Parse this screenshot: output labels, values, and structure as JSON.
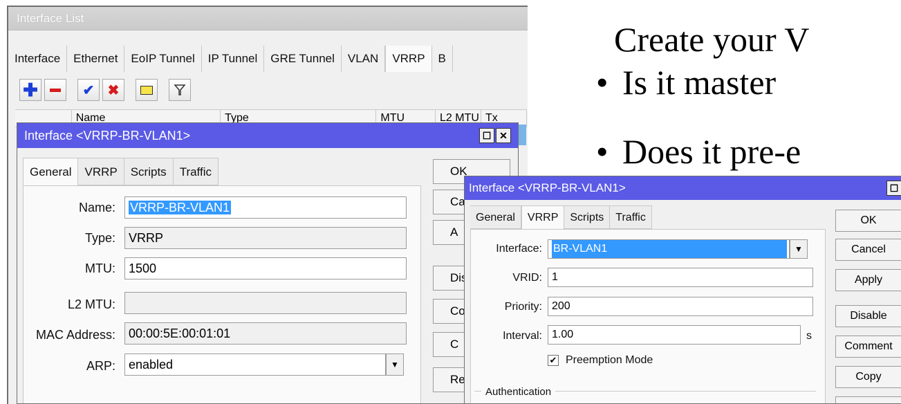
{
  "slide": {
    "title": "Create your V",
    "bullets": [
      "Is it master",
      "Does it pre-e"
    ],
    "bullet_char": "•"
  },
  "interface_list": {
    "title": "Interface List",
    "tabs": [
      "Interface",
      "Ethernet",
      "EoIP Tunnel",
      "IP Tunnel",
      "GRE Tunnel",
      "VLAN",
      "VRRP",
      "B"
    ],
    "active_tab": "VRRP",
    "toolbar": [
      "add-icon",
      "remove-icon",
      "enable-icon",
      "disable-icon",
      "comment-icon",
      "filter-icon"
    ],
    "columns": [
      "",
      "Name",
      "Type",
      "MTU",
      "L2 MTU",
      "Tx"
    ]
  },
  "dialog_general": {
    "title": "Interface <VRRP-BR-VLAN1>",
    "tabs": [
      "General",
      "VRRP",
      "Scripts",
      "Traffic"
    ],
    "active_tab": "General",
    "fields": {
      "name": {
        "label": "Name:",
        "value": "VRRP-BR-VLAN1"
      },
      "type": {
        "label": "Type:",
        "value": "VRRP"
      },
      "mtu": {
        "label": "MTU:",
        "value": "1500"
      },
      "l2mtu": {
        "label": "L2 MTU:",
        "value": ""
      },
      "mac": {
        "label": "MAC Address:",
        "value": "00:00:5E:00:01:01"
      },
      "arp": {
        "label": "ARP:",
        "value": "enabled"
      }
    },
    "buttons": [
      "OK",
      "Ca",
      "A",
      "Dis",
      "Con",
      "C",
      "Re"
    ]
  },
  "dialog_vrrp": {
    "title": "Interface <VRRP-BR-VLAN1>",
    "tabs": [
      "General",
      "VRRP",
      "Scripts",
      "Traffic"
    ],
    "active_tab": "VRRP",
    "fields": {
      "interface": {
        "label": "Interface:",
        "value": "BR-VLAN1"
      },
      "vrid": {
        "label": "VRID:",
        "value": "1"
      },
      "priority": {
        "label": "Priority:",
        "value": "200"
      },
      "interval": {
        "label": "Interval:",
        "value": "1.00",
        "unit": "s"
      }
    },
    "preemption": {
      "label": "Preemption Mode",
      "checked": true
    },
    "authentication_label": "Authentication",
    "buttons": [
      "OK",
      "Cancel",
      "Apply",
      "Disable",
      "Comment",
      "Copy"
    ]
  }
}
